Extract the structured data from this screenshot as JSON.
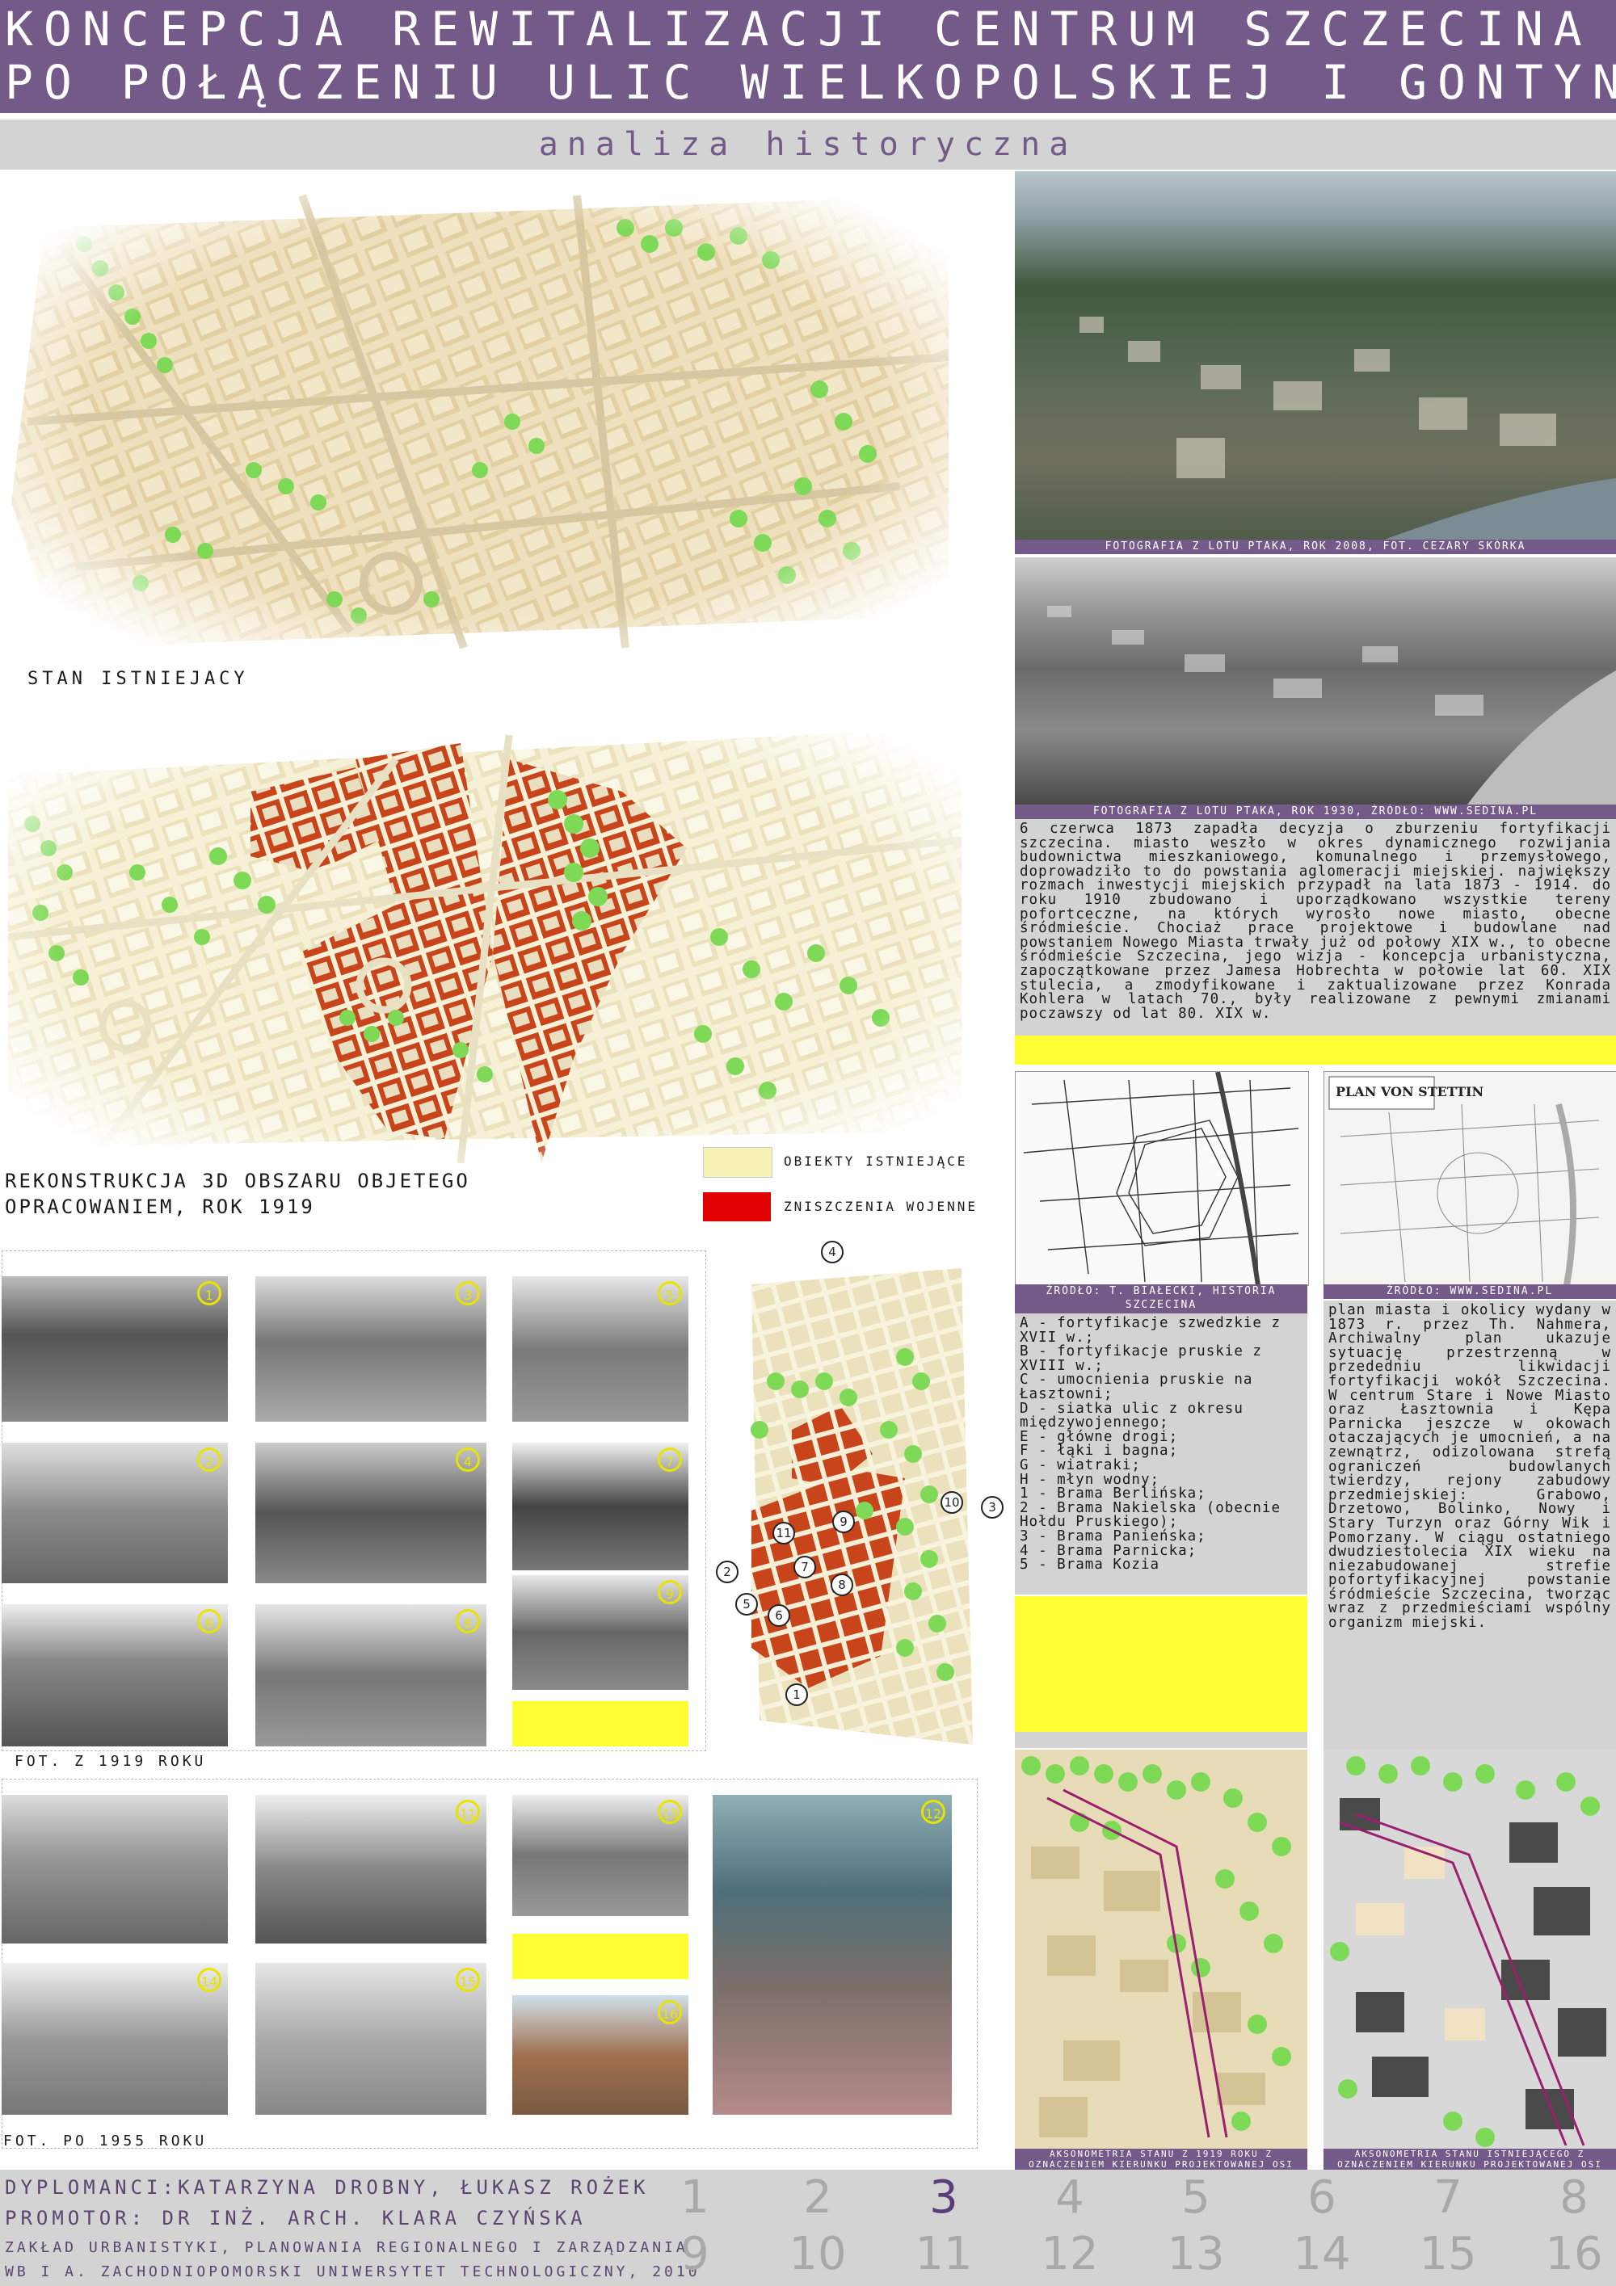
{
  "header": {
    "title_line1": "KONCEPCJA REWITALIZACJI CENTRUM SZCZECINA",
    "title_line2": "PO POŁĄCZENIU ULIC WIELKOPOLSKIEJ I GONTYNY",
    "subtitle": "analiza historyczna"
  },
  "maps": {
    "existing_label": "STAN ISTNIEJACY",
    "reconstruction_label_line1": "REKONSTRUKCJA 3D OBSZARU OBJETEGO",
    "reconstruction_label_line2": "OPRACOWANIEM, ROK 1919",
    "legend": [
      {
        "label": "OBIEKTY ISTNIEJĄCE",
        "color": "#f7f3b5"
      },
      {
        "label": "ZNISZCZENIA WOJENNE",
        "color": "#e00000"
      }
    ]
  },
  "aerial": {
    "caption_2008": "FOTOGRAFIA Z LOTU PTAKA, ROK 2008, FOT. CEZARY SKÓRKA",
    "caption_1930": "FOTOGRAFIA Z LOTU PTAKA, ROK 1930, ŹRÓDŁO: WWW.SEDINA.PL",
    "history_text": "6 czerwca 1873 zapadła decyzja o zburzeniu fortyfikacji szczecina. miasto weszło w okres dynamicznego rozwijania budownictwa mieszkaniowego, komunalnego i przemysłowego, doprowadziło to do powstania aglomeracji miejskiej. największy rozmach inwestycji miejskich przypadł na lata 1873 - 1914. do roku 1910 zbudowano i uporządkowano wszystkie tereny pofortceczne, na których wyrosło nowe miasto, obecne śródmieście. Chociaż prace projektowe i budowlane nad powstaniem Nowego Miasta trwały już od połowy XIX w., to obecne śródmieście Szczecina, jego wizja - koncepcja urbanistyczna, zapoczątkowane przez Jamesa Hobrechta w połowie lat 60. XIX stulecia, a zmodyfikowane i zaktualizowane przez Konrada Kohlera w latach 70., były realizowane z pewnymi zmianami poczawszy od lat 80. XIX w."
  },
  "old_maps": {
    "caption_left": "ŹRÓDŁO: T. BIAŁECKI, HISTORIA SZCZECINA",
    "caption_right": "ŹRÓDŁO: WWW.SEDINA.PL",
    "legend_text": "A - fortyfikacje szwedzkie z XVII w.;\nB - fortyfikacje pruskie z XVIII w.;\nC - umocnienia pruskie na Łasztowni;\nD - siatka ulic z okresu międzywojennego;\nE - główne drogi;\nF - łąki i bagna;\nG - wiatraki;\nH - młyn wodny;\n1 - Brama Berlińska;\n2 - Brama Nakielska (obecnie Hołdu Pruskiego);\n3 - Brama Panieńska;\n4 - Brama Parnicka;\n5 - Brama Kozia",
    "plan_text": "plan miasta i okolicy wydany w 1873 r. przez Th. Nahmera, Archiwalny plan ukazuje sytuację przestrzenną w przededniu likwidacji fortyfikacji wokół Szczecina. W centrum Stare i Nowe Miasto oraz Łasztownia i Kępa Parnicka jeszcze w okowach otaczających je umocnień, a na zewnątrz, odizolowana strefą ograniczeń budowlanych twierdzy, rejony zabudowy przedmiejskiej: Grabowo, Drzetowo, Bolinko, Nowy i Stary Turzyn oraz Górny Wik i Pomorzany. W ciągu ostatniego dwudziestolecia XIX wieku na niezabudowanej strefie pofortyfikacyjnej powstanie śródmieście Szczecina, tworząc wraz z przedmieściami wspólny organizm miejski."
  },
  "photos": {
    "caption_1919": "FOT. Z 1919 ROKU",
    "caption_1955": "FOT. PO 1955 ROKU",
    "markers_1919": [
      "1",
      "3",
      "5",
      "2",
      "4",
      "7",
      "6",
      "8",
      "9"
    ],
    "markers_1955": [
      "11",
      "12",
      "13",
      "14",
      "15",
      "16"
    ],
    "map_numbers": [
      "4",
      "10",
      "3",
      "9",
      "11",
      "2",
      "7",
      "8",
      "5",
      "6",
      "1"
    ]
  },
  "axonometry": {
    "caption_1919": "AKSONOMETRIA STANU Z 1919 ROKU Z OZNACZENIEM KIERUNKU PROJEKTOWANEJ OSI",
    "caption_existing": "AKSONOMETRIA STANU ISTNIEJĄCEGO Z OZNACZENIEM KIERUNKU PROJEKTOWANEJ OSI"
  },
  "footer": {
    "authors": "DYPLOMANCI:KATARZYNA DROBNY, ŁUKASZ ROŻEK",
    "promotor": "PROMOTOR:          DR INŻ. ARCH. KLARA CZYŃSKA",
    "department": "ZAKŁAD URBANISTYKI, PLANOWANIA REGIONALNEGO  I ZARZĄDZANIA",
    "university": "WB I A. ZACHODNIOPOMORSKI UNIWERSYTET TECHNOLOGICZNY, 2010",
    "pages_row1": [
      "1",
      "2",
      "3",
      "4",
      "5",
      "6",
      "7",
      "8"
    ],
    "pages_row2": [
      "9",
      "10",
      "11",
      "12",
      "13",
      "14",
      "15",
      "16"
    ],
    "current_page": "3"
  },
  "colors": {
    "purple": "#735a89",
    "gray": "#d3d3d3",
    "yellow": "#ffff33",
    "war_damage": "#c8451c",
    "existing": "#f0e2c2",
    "greenery": "#7ed957"
  }
}
